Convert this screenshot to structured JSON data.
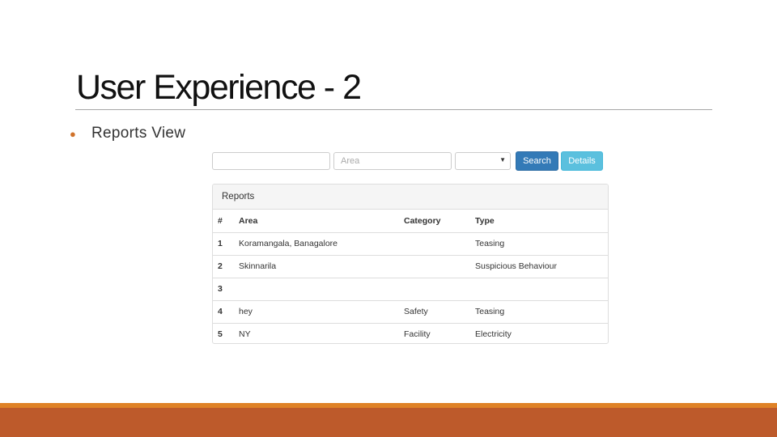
{
  "slide": {
    "title": "User Experience - 2",
    "bullet": "Reports View"
  },
  "search_bar": {
    "field1_placeholder": "",
    "area_placeholder": "Area",
    "select_value": "",
    "search_label": "Search",
    "details_label": "Details"
  },
  "reports": {
    "heading": "Reports",
    "columns": [
      "#",
      "Area",
      "Category",
      "Type"
    ],
    "rows": [
      {
        "num": "1",
        "area": "Koramangala, Banagalore",
        "category": "",
        "type": "Teasing"
      },
      {
        "num": "2",
        "area": "Skinnarila",
        "category": "",
        "type": "Suspicious Behaviour"
      },
      {
        "num": "3",
        "area": "",
        "category": "",
        "type": ""
      },
      {
        "num": "4",
        "area": "hey",
        "category": "Safety",
        "type": "Teasing"
      },
      {
        "num": "5",
        "area": "NY",
        "category": "Facility",
        "type": "Electricity"
      }
    ]
  },
  "colors": {
    "accent_orange": "#df8226",
    "band_rust": "#bd5a2b",
    "primary_blue": "#337ab7",
    "info_blue": "#5bc0de"
  }
}
